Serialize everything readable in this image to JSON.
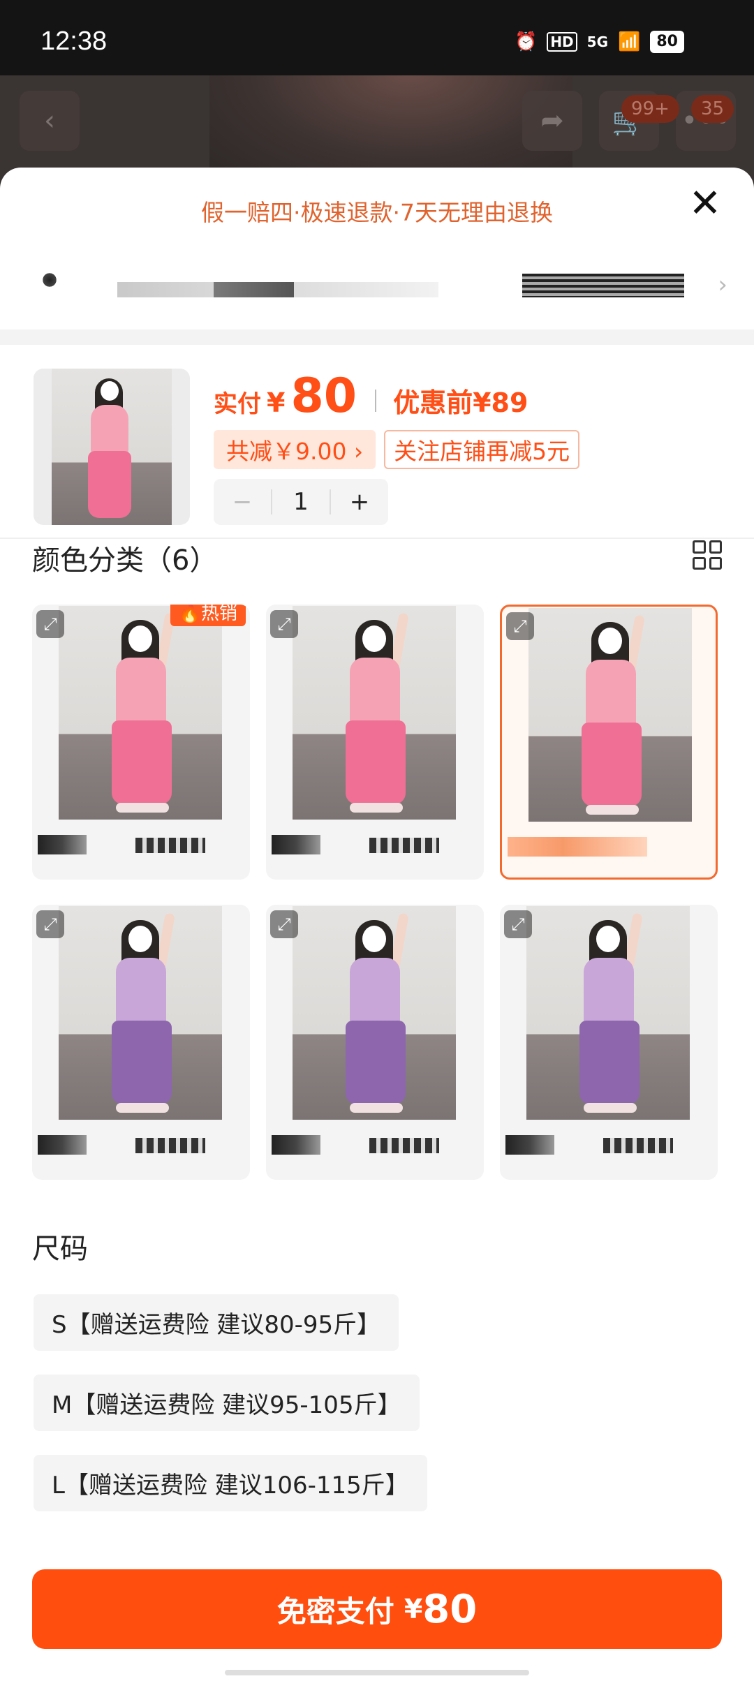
{
  "status_bar": {
    "time": "12:38",
    "network": "5G",
    "hd": "HD",
    "battery": "80"
  },
  "background": {
    "cart_badge": "99+",
    "msg_badge": "35"
  },
  "sheet": {
    "guarantee": "假一赔四·极速退款·7天无理由退换",
    "close_icon": "close-icon"
  },
  "product": {
    "pay_label": "实付",
    "currency": "¥",
    "price": "80",
    "orig_label": "优惠前¥89",
    "discount_chip": "共减￥9.00 ›",
    "follow_chip": "关注店铺再减5元",
    "qty_minus": "−",
    "quantity": "1",
    "qty_plus": "+"
  },
  "colors_section": {
    "title": "颜色分类（6）",
    "hot_badge": "🔥热销",
    "items": [
      {
        "tone": "pink",
        "selected": false,
        "hot": true
      },
      {
        "tone": "pink",
        "selected": false,
        "hot": false
      },
      {
        "tone": "pink",
        "selected": true,
        "hot": false
      },
      {
        "tone": "purple",
        "selected": false,
        "hot": false
      },
      {
        "tone": "purple",
        "selected": false,
        "hot": false
      },
      {
        "tone": "purple",
        "selected": false,
        "hot": false
      }
    ]
  },
  "size_section": {
    "title": "尺码",
    "items": [
      "S【赠送运费险 建议80-95斤】",
      "M【赠送运费险 建议95-105斤】",
      "L【赠送运费险 建议106-115斤】"
    ]
  },
  "pay_button": {
    "label": "免密支付",
    "currency": "¥",
    "price": "80"
  },
  "theme": {
    "accent": "#ff4e0e",
    "accent_text": "#e0632e"
  }
}
